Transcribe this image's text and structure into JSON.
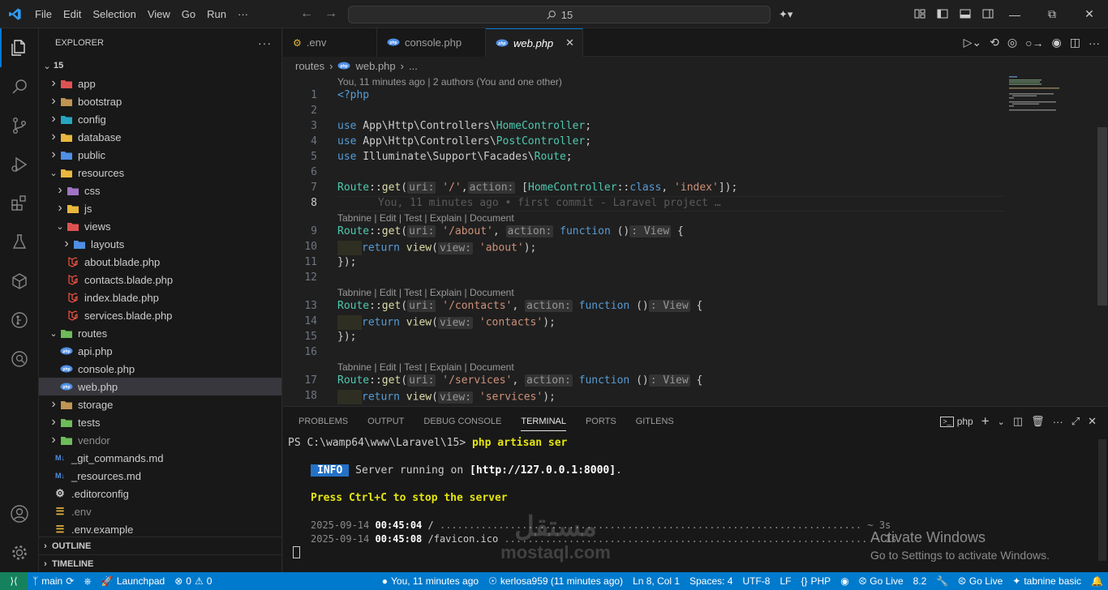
{
  "titlebar": {
    "menu": [
      "File",
      "Edit",
      "Selection",
      "View",
      "Go",
      "Run",
      "···"
    ],
    "search": "15"
  },
  "sidebar": {
    "title": "EXPLORER",
    "root": "15",
    "items": [
      {
        "label": "app",
        "depth": 1,
        "type": "folder",
        "icon_color": "#e05252",
        "open": false
      },
      {
        "label": "bootstrap",
        "depth": 1,
        "type": "folder",
        "icon_color": "#c09553",
        "open": false
      },
      {
        "label": "config",
        "depth": 1,
        "type": "folder",
        "icon_color": "#26a6c1",
        "open": false
      },
      {
        "label": "database",
        "depth": 1,
        "type": "folder",
        "icon_color": "#e8b73e",
        "open": false
      },
      {
        "label": "public",
        "depth": 1,
        "type": "folder",
        "icon_color": "#4f8fe6",
        "open": false
      },
      {
        "label": "resources",
        "depth": 1,
        "type": "folder",
        "icon_color": "#e8b73e",
        "open": true
      },
      {
        "label": "css",
        "depth": 2,
        "type": "folder",
        "icon_color": "#a074c4",
        "open": false
      },
      {
        "label": "js",
        "depth": 2,
        "type": "folder",
        "icon_color": "#e8b73e",
        "open": false
      },
      {
        "label": "views",
        "depth": 2,
        "type": "folder",
        "icon_color": "#e05252",
        "open": true
      },
      {
        "label": "layouts",
        "depth": 3,
        "type": "folder",
        "icon_color": "#4f8fe6",
        "open": false
      },
      {
        "label": "about.blade.php",
        "depth": 3,
        "type": "blade",
        "icon_color": "#f05340"
      },
      {
        "label": "contacts.blade.php",
        "depth": 3,
        "type": "blade",
        "icon_color": "#f05340"
      },
      {
        "label": "index.blade.php",
        "depth": 3,
        "type": "blade",
        "icon_color": "#f05340"
      },
      {
        "label": "services.blade.php",
        "depth": 3,
        "type": "blade",
        "icon_color": "#f05340"
      },
      {
        "label": "routes",
        "depth": 1,
        "type": "folder",
        "icon_color": "#6dbb5a",
        "open": true
      },
      {
        "label": "api.php",
        "depth": 2,
        "type": "php",
        "icon_color": "#4f8fe6"
      },
      {
        "label": "console.php",
        "depth": 2,
        "type": "php",
        "icon_color": "#4f8fe6"
      },
      {
        "label": "web.php",
        "depth": 2,
        "type": "php",
        "icon_color": "#4f8fe6",
        "selected": true
      },
      {
        "label": "storage",
        "depth": 1,
        "type": "folder",
        "icon_color": "#c09553",
        "open": false
      },
      {
        "label": "tests",
        "depth": 1,
        "type": "folder",
        "icon_color": "#6dbb5a",
        "open": false
      },
      {
        "label": "vendor",
        "depth": 1,
        "type": "folder",
        "icon_color": "#6dbb5a",
        "open": false,
        "dim": true
      },
      {
        "label": "_git_commands.md",
        "depth": 1,
        "type": "md",
        "icon_color": "#4f8fe6"
      },
      {
        "label": "_resources.md",
        "depth": 1,
        "type": "md",
        "icon_color": "#4f8fe6"
      },
      {
        "label": ".editorconfig",
        "depth": 1,
        "type": "gear",
        "icon_color": "#cccccc"
      },
      {
        "label": ".env",
        "depth": 1,
        "type": "env",
        "icon_color": "#e8b73e",
        "dim": true
      },
      {
        "label": ".env.example",
        "depth": 1,
        "type": "env",
        "icon_color": "#e8b73e"
      }
    ],
    "outline": "OUTLINE",
    "timeline": "TIMELINE"
  },
  "tabs": [
    {
      "label": ".env",
      "icon": "gear-icon",
      "active": false
    },
    {
      "label": "console.php",
      "icon": "php-icon",
      "active": false
    },
    {
      "label": "web.php",
      "icon": "php-icon",
      "active": true
    }
  ],
  "breadcrumb": {
    "folder": "routes",
    "file": "web.php",
    "more": "..."
  },
  "editor": {
    "blame_header": "You, 11 minutes ago | 2 authors (You and one other)",
    "inline_blame": "You, 11 minutes ago • first commit - Laravel project …",
    "codelens": "Tabnine | Edit | Test | Explain | Document",
    "line_numbers": [
      "1",
      "2",
      "3",
      "4",
      "5",
      "6",
      "7",
      "8",
      "9",
      "10",
      "11",
      "12",
      "13",
      "14",
      "15",
      "16",
      "17",
      "18"
    ]
  },
  "panel": {
    "tabs": [
      "PROBLEMS",
      "OUTPUT",
      "DEBUG CONSOLE",
      "TERMINAL",
      "PORTS",
      "GITLENS"
    ],
    "active_tab": "TERMINAL",
    "shell": "php",
    "prompt": "PS C:\\wamp64\\www\\Laravel\\15> ",
    "command": "php artisan ser",
    "info_badge": "INFO",
    "info_text": " Server running on ",
    "info_url": "[http://127.0.0.1:8000]",
    "info_end": ".",
    "ctrl_c": "Press Ctrl+C to stop the server",
    "log1_date": "2025-09-14 ",
    "log1_time": "00:45:04",
    "log1_path": " / ",
    "log1_dots": "........................................................................",
    "log1_dur": " ~ 3s",
    "log2_date": "2025-09-14 ",
    "log2_time": "00:45:08",
    "log2_path": " /favicon.ico ",
    "log2_dots": "..............................................................",
    "log2_dur": " ~ 1s",
    "activate_title": "Activate Windows",
    "activate_sub": "Go to Settings to activate Windows."
  },
  "watermark": {
    "arabic": "مستقل",
    "latin": "mostaql.com"
  },
  "statusbar": {
    "branch": "main",
    "launchpad": "Launchpad",
    "errors": "0",
    "warnings": "0",
    "blame": "You, 11 minutes ago",
    "author": "kerlosa959 (11 minutes ago)",
    "position": "Ln 8, Col 1",
    "spaces": "Spaces: 4",
    "encoding": "UTF-8",
    "eol": "LF",
    "language": "PHP",
    "golive1": "Go Live",
    "version": "8.2",
    "golive2": "Go Live",
    "tabnine": "tabnine basic"
  },
  "colors": {
    "accent": "#0078d4",
    "statusbar": "#007acc",
    "remote": "#16825d"
  }
}
